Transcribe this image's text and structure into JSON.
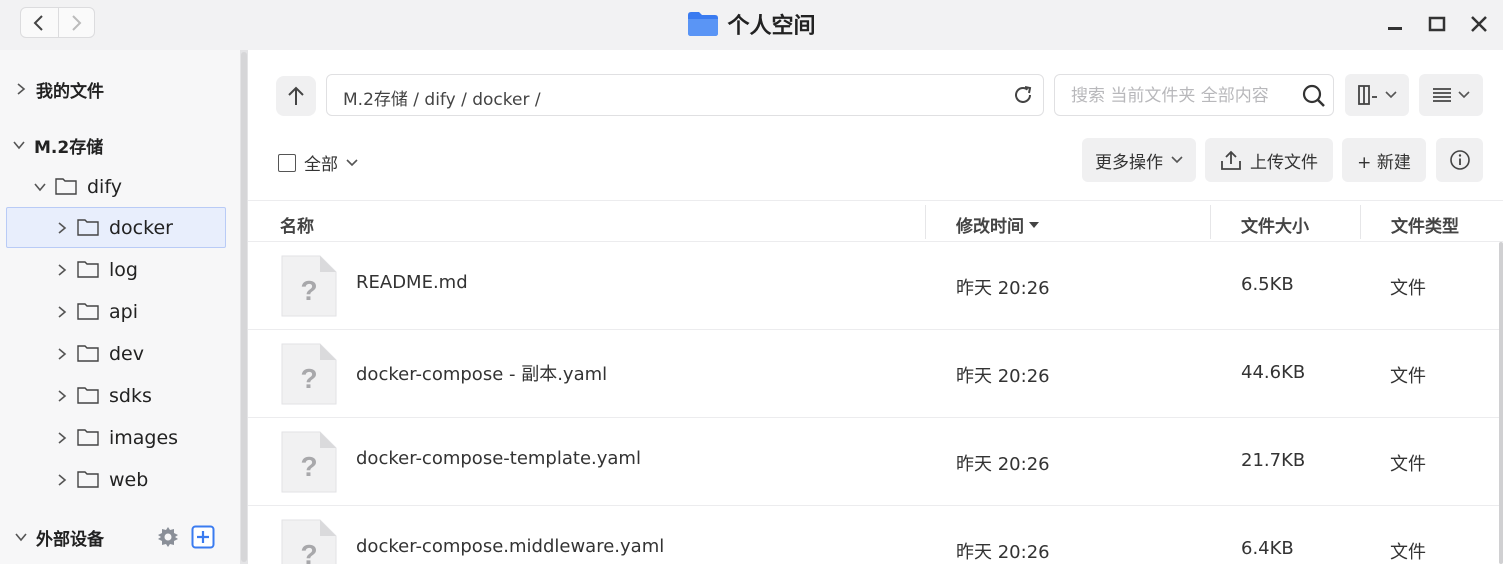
{
  "window": {
    "title": "个人空间"
  },
  "sidebar": {
    "my_files": "我的文件",
    "storage": "M.2存储",
    "tree": [
      {
        "label": "dify",
        "level": 1,
        "expanded": true
      },
      {
        "label": "docker",
        "level": 2,
        "selected": true
      },
      {
        "label": "log",
        "level": 2
      },
      {
        "label": "api",
        "level": 2
      },
      {
        "label": "dev",
        "level": 2
      },
      {
        "label": "sdks",
        "level": 2
      },
      {
        "label": "images",
        "level": 2
      },
      {
        "label": "web",
        "level": 2
      }
    ],
    "external": "外部设备"
  },
  "toolbar": {
    "path": "M.2存储 / dify / docker /",
    "search_placeholder": "搜索 当前文件夹 全部内容",
    "select_all": "全部",
    "more_actions": "更多操作",
    "upload": "上传文件",
    "new": "+ 新建"
  },
  "table": {
    "columns": {
      "name": "名称",
      "modified": "修改时间",
      "size": "文件大小",
      "type": "文件类型"
    },
    "rows": [
      {
        "name": "README.md",
        "modified": "昨天 20:26",
        "size": "6.5KB",
        "type": "文件"
      },
      {
        "name": "docker-compose - 副本.yaml",
        "modified": "昨天 20:26",
        "size": "44.6KB",
        "type": "文件"
      },
      {
        "name": "docker-compose-template.yaml",
        "modified": "昨天 20:26",
        "size": "21.7KB",
        "type": "文件"
      },
      {
        "name": "docker-compose.middleware.yaml",
        "modified": "昨天 20:26",
        "size": "6.4KB",
        "type": "文件"
      }
    ]
  },
  "colors": {
    "accent": "#3a7bf0",
    "selected_bg": "#e8eefc"
  }
}
